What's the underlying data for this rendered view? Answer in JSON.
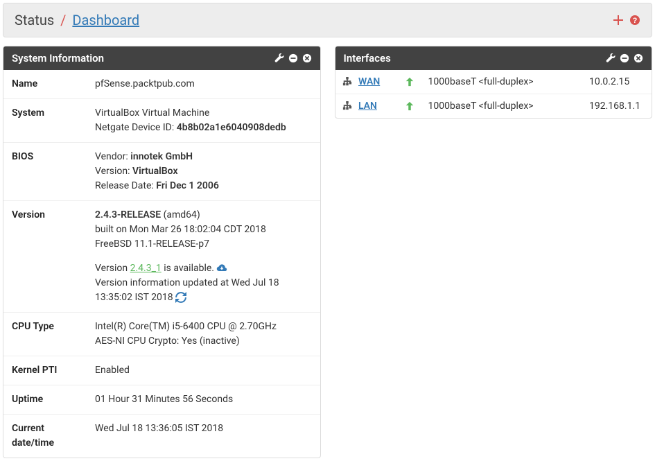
{
  "header": {
    "status": "Status",
    "dashboard": "Dashboard"
  },
  "sysinfo": {
    "title": "System Information",
    "rows": {
      "name_label": "Name",
      "name_value": "pfSense.packtpub.com",
      "system_label": "System",
      "system_line1": "VirtualBox Virtual Machine",
      "system_line2_prefix": "Netgate Device ID: ",
      "system_line2_bold": "4b8b02a1e6040908dedb",
      "bios_label": "BIOS",
      "bios_vendor_prefix": "Vendor: ",
      "bios_vendor_bold": "innotek GmbH",
      "bios_version_prefix": "Version: ",
      "bios_version_bold": "VirtualBox",
      "bios_date_prefix": "Release Date: ",
      "bios_date_bold": "Fri Dec 1 2006",
      "version_label": "Version",
      "version_bold": "2.4.3-RELEASE",
      "version_arch": " (amd64)",
      "version_built": "built on Mon Mar 26 18:02:04 CDT 2018",
      "version_freebsd": "FreeBSD 11.1-RELEASE-p7",
      "version_avail_prefix": "Version ",
      "version_avail_link": "2.4.3_1",
      "version_avail_suffix": " is available. ",
      "version_updated": "Version information updated at Wed Jul 18 13:35:02 IST 2018 ",
      "cpu_label": "CPU Type",
      "cpu_line1": "Intel(R) Core(TM) i5-6400 CPU @ 2.70GHz",
      "cpu_line2": "AES-NI CPU Crypto: Yes (inactive)",
      "pti_label": "Kernel PTI",
      "pti_value": "Enabled",
      "uptime_label": "Uptime",
      "uptime_value": "01 Hour 31 Minutes 56 Seconds",
      "datetime_label": "Current date/time",
      "datetime_value": "Wed Jul 18 13:36:05 IST 2018"
    }
  },
  "interfaces": {
    "title": "Interfaces",
    "rows": [
      {
        "name": "WAN",
        "media": "1000baseT <full-duplex>",
        "ip": "10.0.2.15"
      },
      {
        "name": "LAN",
        "media": "1000baseT <full-duplex>",
        "ip": "192.168.1.1"
      }
    ]
  }
}
